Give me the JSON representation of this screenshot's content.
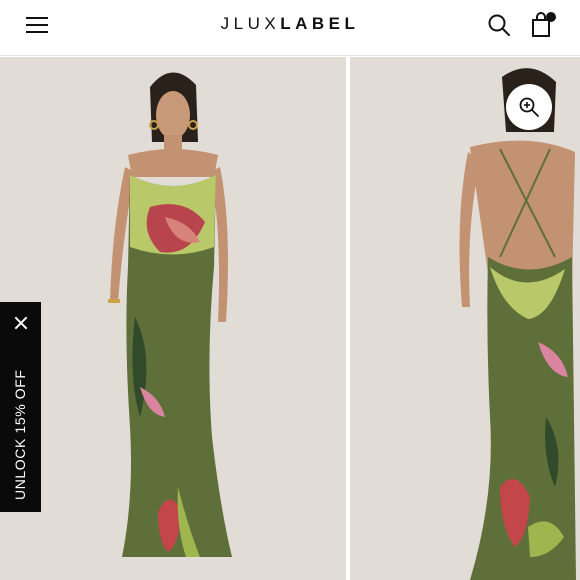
{
  "header": {
    "logo_light": "JLUX",
    "logo_bold": "LABEL",
    "menu_icon": "hamburger-menu-icon",
    "search_icon": "search-icon",
    "cart_icon": "shopping-bag-icon",
    "cart_badge_color": "#111111"
  },
  "gallery": {
    "zoom_icon": "zoom-in-icon",
    "dress_color": "#5f6f3a",
    "background_color": "#e2dcd6"
  },
  "promo": {
    "label": "UNLOCK 15% OFF",
    "close_icon": "close-icon",
    "background_color": "#0a0a0a"
  }
}
